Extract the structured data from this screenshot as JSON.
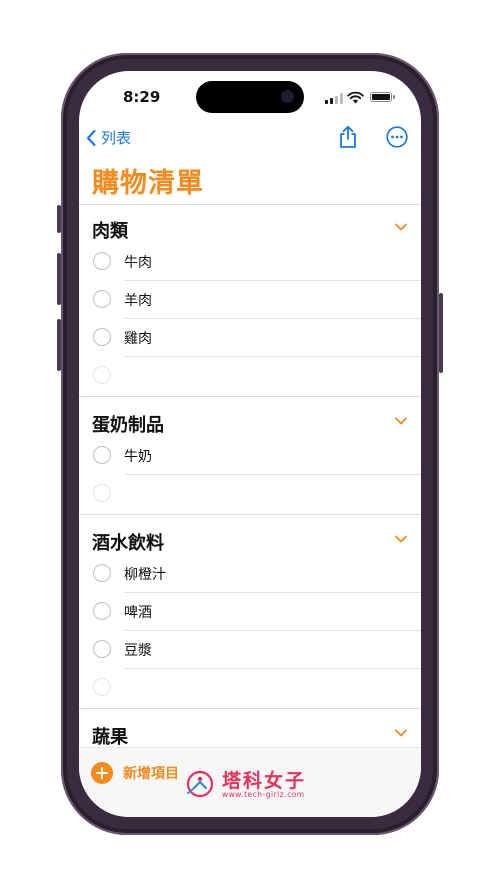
{
  "status": {
    "time": "8:29"
  },
  "nav": {
    "back_label": "列表"
  },
  "list": {
    "title": "購物清單"
  },
  "sections": [
    {
      "title": "肉類",
      "items": [
        "牛肉",
        "羊肉",
        "雞肉"
      ]
    },
    {
      "title": "蛋奶制品",
      "items": [
        "牛奶"
      ]
    },
    {
      "title": "酒水飲料",
      "items": [
        "柳橙汁",
        "啤酒",
        "豆漿"
      ]
    },
    {
      "title": "蔬果",
      "items": []
    }
  ],
  "toolbar": {
    "add_label": "新增項目"
  },
  "watermark": {
    "title": "塔科女子",
    "subtitle": "www.tech-girlz.com"
  },
  "colors": {
    "accent": "#f48b1c",
    "link": "#1a78e6",
    "watermark": "#e8305a"
  }
}
